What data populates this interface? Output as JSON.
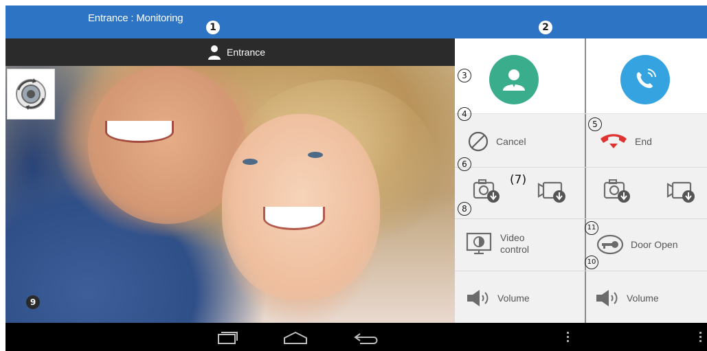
{
  "title_bar": {
    "title": "Entrance : Monitoring"
  },
  "camera": {
    "header_label": "Entrance"
  },
  "panel": {
    "left": {
      "cancel_label": "Cancel",
      "video_control_line1": "Video",
      "video_control_line2": "control",
      "volume_label": "Volume"
    },
    "right": {
      "end_label": "End",
      "door_open_label": "Door Open",
      "volume_label": "Volume"
    }
  },
  "callouts": {
    "c1": "1",
    "c2": "2",
    "c3": "3",
    "c4": "4",
    "c5": "5",
    "c6": "6",
    "c7": "(7)",
    "c8": "8",
    "c9": "9",
    "c10": "10",
    "c11": "11"
  },
  "icons": {
    "rotate": "camera-rotate-icon",
    "person": "person-icon",
    "phone": "phone-icon",
    "cancel": "cancel-icon",
    "end": "hang-up-icon",
    "snapshot": "snapshot-save-icon",
    "record": "video-record-icon",
    "video_control": "video-control-icon",
    "door_open": "door-key-icon",
    "volume": "volume-icon",
    "nav_recent": "recent-apps-icon",
    "nav_home": "home-icon",
    "nav_back": "back-icon",
    "nav_menu": "menu-icon"
  },
  "colors": {
    "title_bar": "#2d74c4",
    "accept_green": "#3aad8c",
    "call_blue": "#34a3df",
    "end_red": "#e0322f",
    "icon_gray": "#6b6b6b"
  }
}
